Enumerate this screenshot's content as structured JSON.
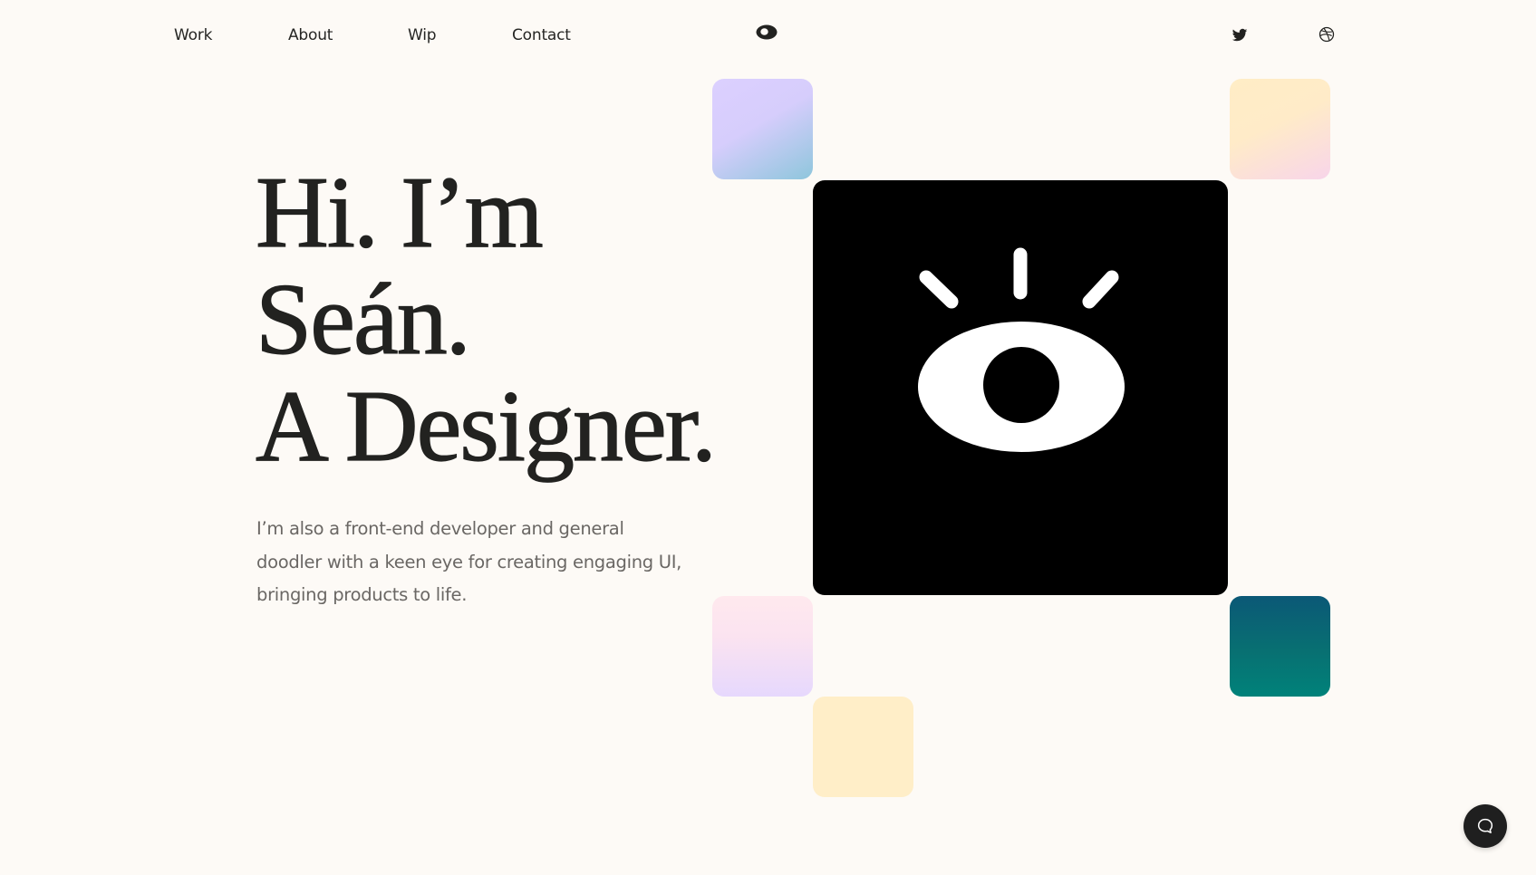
{
  "nav": {
    "links": [
      {
        "label": "Work"
      },
      {
        "label": "About"
      },
      {
        "label": "Wip"
      },
      {
        "label": "Contact"
      }
    ],
    "logo_icon": "eye-logo-icon",
    "social": [
      {
        "name": "Twitter",
        "icon": "twitter-icon"
      },
      {
        "name": "Dribbble",
        "icon": "dribbble-icon"
      }
    ]
  },
  "hero": {
    "title_lines": [
      "Hi. I’m",
      "Seán.",
      "A Designer."
    ],
    "subtitle": "I’m also a front-end developer and general doodler with a keen eye for creating engaging UI, bringing products to life.",
    "art_icon": "eye-illustration-icon"
  },
  "tiles": {
    "colors": {
      "lavender_blue": [
        "#dcd0ff",
        "#8ec6dc"
      ],
      "cream_pink": [
        "#ffedc6",
        "#f8d5ea"
      ],
      "pink_lavender": [
        "#ffe9ee",
        "#e6d8fd"
      ],
      "cream": "#ffeec8",
      "teal": [
        "#0b5876",
        "#00827a"
      ]
    }
  },
  "chat": {
    "icon": "chat-bubble-icon",
    "label": "Open chat"
  },
  "theme": {
    "background": "#fdfaf6",
    "text": "#222220",
    "muted_text": "#6a6764",
    "art_background": "#000000"
  }
}
